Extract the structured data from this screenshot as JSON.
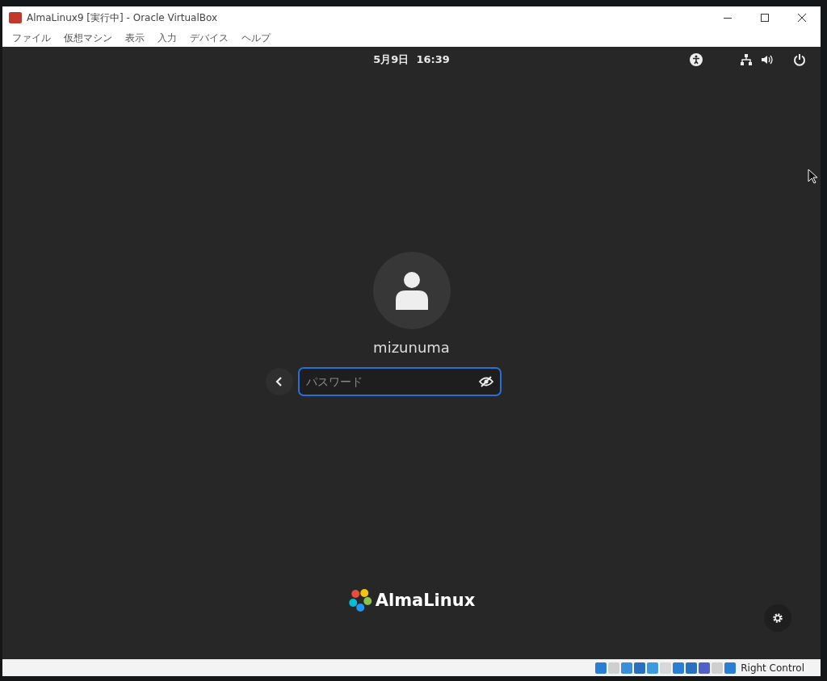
{
  "window": {
    "title": "AlmaLinux9 [実行中] - Oracle VirtualBox"
  },
  "menu": [
    "ファイル",
    "仮想マシン",
    "表示",
    "入力",
    "デバイス",
    "ヘルプ"
  ],
  "top_bar": {
    "clock": "5月9日  16:39"
  },
  "login": {
    "username": "mizunuma",
    "password": {
      "placeholder": "パスワード"
    }
  },
  "logo": {
    "text": "AlmaLinux"
  },
  "status_bar": {
    "host_key": "Right Control"
  }
}
